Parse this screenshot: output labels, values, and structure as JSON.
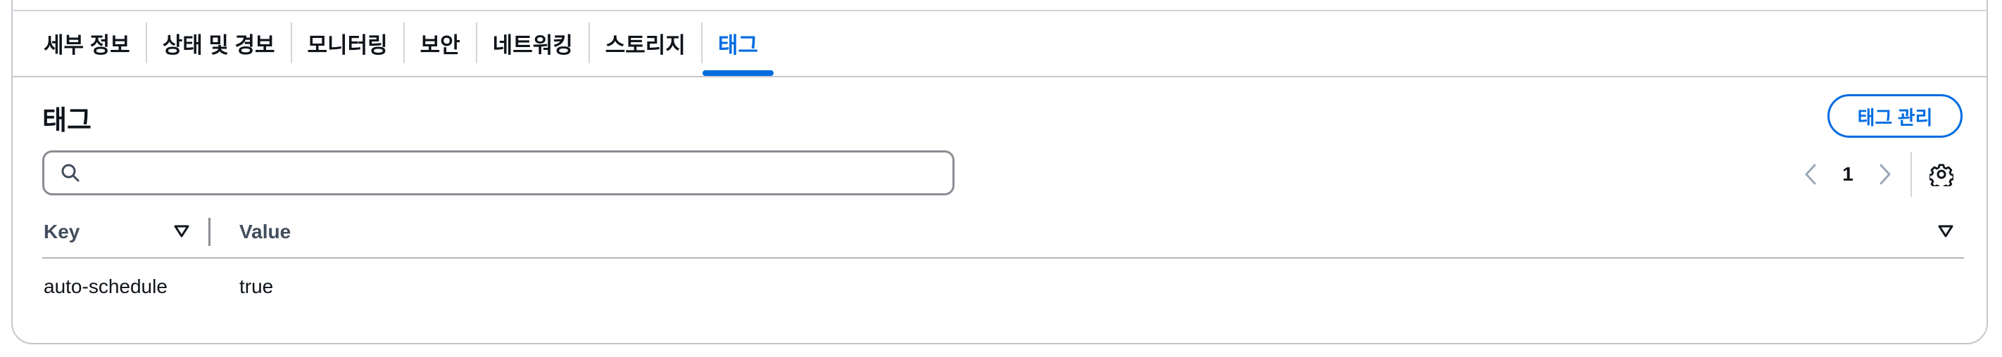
{
  "tabs": [
    {
      "label": "세부 정보",
      "active": false
    },
    {
      "label": "상태 및 경보",
      "active": false
    },
    {
      "label": "모니터링",
      "active": false
    },
    {
      "label": "보안",
      "active": false
    },
    {
      "label": "네트워킹",
      "active": false
    },
    {
      "label": "스토리지",
      "active": false
    },
    {
      "label": "태그",
      "active": true
    }
  ],
  "section": {
    "title": "태그",
    "manage_button": "태그 관리"
  },
  "search": {
    "value": "",
    "placeholder": ""
  },
  "pagination": {
    "current_page": "1"
  },
  "table": {
    "columns": [
      "Key",
      "Value"
    ],
    "rows": [
      {
        "key": "auto-schedule",
        "value": "true"
      }
    ]
  },
  "colors": {
    "accent": "#006ce0",
    "text": "#0f141a",
    "muted": "#414d5c",
    "border": "#c6c6cd"
  },
  "icons": [
    "search-icon",
    "chevron-left-icon",
    "chevron-right-icon",
    "gear-icon",
    "sort-down-icon"
  ]
}
